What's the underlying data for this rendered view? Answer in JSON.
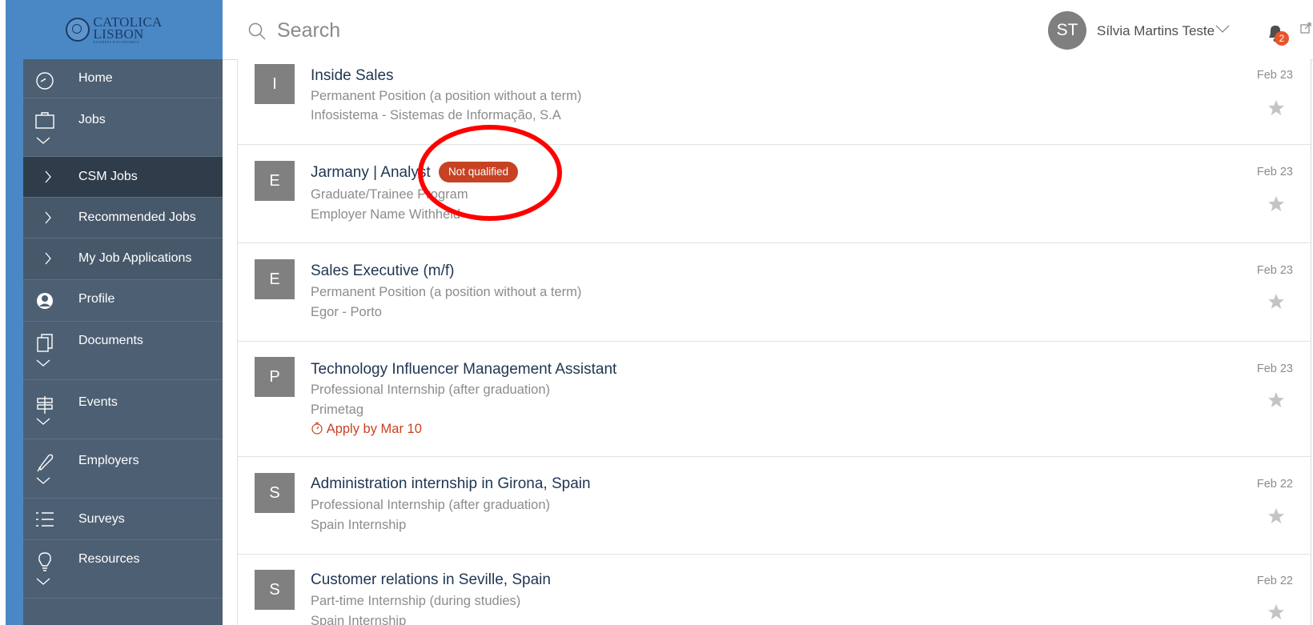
{
  "sidebar": {
    "logo": {
      "line1": "CATOLICA",
      "line2": "LISBON",
      "tagline": "BUSINESS & ECONOMICS"
    },
    "items": [
      {
        "label": "Home",
        "icon": "dashboard-icon"
      },
      {
        "label": "Jobs",
        "icon": "briefcase-icon"
      },
      {
        "label": "CSM Jobs",
        "icon": "chevron-right-icon"
      },
      {
        "label": "Recommended Jobs",
        "icon": "chevron-right-icon"
      },
      {
        "label": "My Job Applications",
        "icon": "chevron-right-icon"
      },
      {
        "label": "Profile",
        "icon": "profile-icon"
      },
      {
        "label": "Documents",
        "icon": "documents-icon"
      },
      {
        "label": "Events",
        "icon": "signpost-icon"
      },
      {
        "label": "Employers",
        "icon": "rocket-icon"
      },
      {
        "label": "Surveys",
        "icon": "list-icon"
      },
      {
        "label": "Resources",
        "icon": "lightbulb-icon"
      }
    ]
  },
  "header": {
    "search_placeholder": "Search",
    "avatar_initials": "ST",
    "user_name": "Sílvia Martins Teste",
    "notification_count": "2"
  },
  "jobs": [
    {
      "initial": "I",
      "title": "Inside Sales",
      "type": "Permanent Position (a position without a term)",
      "company": "Infosistema - Sistemas de Informação, S.A",
      "date": "Feb 23"
    },
    {
      "initial": "E",
      "title": "Jarmany | Analyst",
      "badge": "Not qualified",
      "type": "Graduate/Trainee Program",
      "company": "Employer Name Withheld",
      "date": "Feb 23"
    },
    {
      "initial": "E",
      "title": "Sales Executive (m/f)",
      "type": "Permanent Position (a position without a term)",
      "company": "Egor - Porto",
      "date": "Feb 23"
    },
    {
      "initial": "P",
      "title": "Technology Influencer Management Assistant",
      "type": "Professional Internship (after graduation)",
      "company": "Primetag",
      "deadline": "Apply by Mar 10",
      "date": "Feb 23"
    },
    {
      "initial": "S",
      "title": "Administration internship in Girona, Spain",
      "type": "Professional Internship (after graduation)",
      "company": "Spain Internship",
      "date": "Feb 22"
    },
    {
      "initial": "S",
      "title": "Customer relations in Seville, Spain",
      "type": "Part-time Internship (during studies)",
      "company": "Spain Internship",
      "date": "Feb 22"
    }
  ],
  "colors": {
    "sidebar_blue": "#4a88c5",
    "nav_bg": "#4d5f73",
    "nav_active": "#2f3d4b",
    "badge_red": "#c74223",
    "annotation_red": "#ff0000"
  }
}
